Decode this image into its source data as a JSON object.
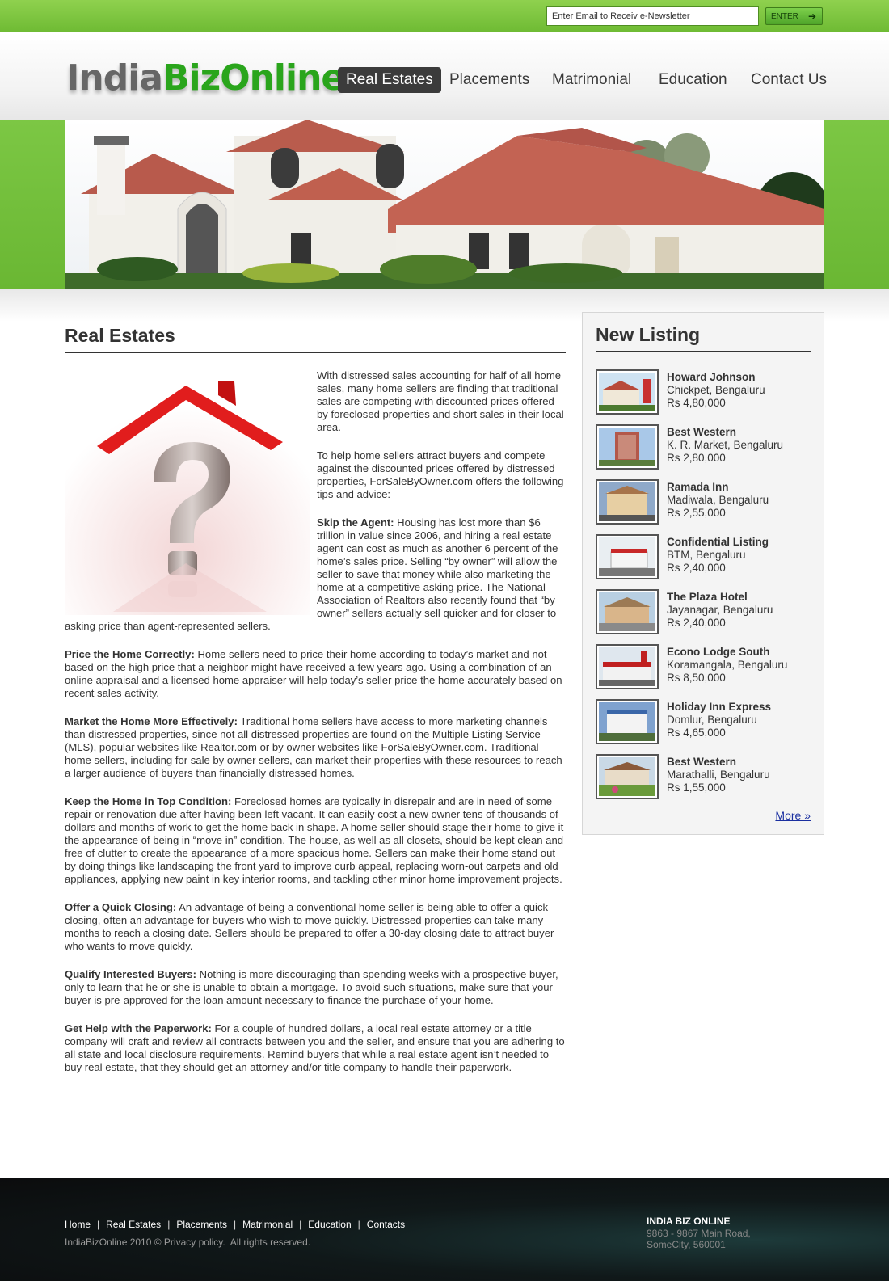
{
  "newsletter": {
    "input_value": "Enter Email to Receiv e-Newsletter",
    "button_label": "ENTER"
  },
  "header": {
    "logo_part1": "India",
    "logo_part2": "BizOnline",
    "nav": [
      {
        "label": "Real Estates",
        "active": true
      },
      {
        "label": "Placements"
      },
      {
        "label": "Matrimonial"
      },
      {
        "label": "Education"
      },
      {
        "label": "Contact Us"
      }
    ]
  },
  "main": {
    "title": "Real Estates",
    "paragraphs": [
      {
        "lead": "",
        "text": "With distressed sales accounting for half of all home sales, many home sellers are finding that traditional sales are competing with discounted prices offered by foreclosed properties and short sales in their local area."
      },
      {
        "lead": "",
        "text": "To help home sellers attract buyers and compete against the discounted prices offered by distressed properties, ForSaleByOwner.com offers the following tips and advice:"
      },
      {
        "lead": "Skip the Agent:",
        "text": " Housing has lost more than $6 trillion in value since 2006, and hiring a real estate agent can cost as much as another 6 percent of the home’s sales price. Selling “by owner” will allow the seller to save that money while also marketing the home at a competitive asking price. The National Association of Realtors also recently found that “by owner” sellers actually sell quicker and for closer to asking price than agent-represented sellers."
      },
      {
        "lead": "Price the Home Correctly:",
        "text": " Home sellers need to price their home according to today’s market and not based on the high price that a neighbor might have received a few years ago. Using a combination of an online appraisal and a licensed home appraiser will help today’s seller price the home accurately based on recent sales activity."
      },
      {
        "lead": "Market the Home More Effectively:",
        "text": " Traditional home sellers have access to more marketing channels than distressed properties, since not all distressed properties are found on the Multiple Listing Service (MLS), popular websites like Realtor.com or by owner websites like ForSaleByOwner.com. Traditional home sellers, including for sale by owner sellers, can market their properties with these resources to reach a larger audience of buyers than financially distressed homes."
      },
      {
        "lead": "Keep the Home in Top Condition:",
        "text": " Foreclosed homes are typically in disrepair and are in need of some repair or renovation due after having been left vacant. It can easily cost a new owner tens of thousands of dollars and months of work to get the home back in shape. A home seller should stage their home to give it the appearance of being in “move in” condition. The house, as well as all closets, should be kept clean and free of clutter to create the appearance of a more spacious home.  Sellers can make their home stand out by doing things like landscaping the front yard to improve curb appeal, replacing worn-out carpets and old appliances, applying new paint in key interior rooms, and tackling other minor home improvement projects."
      },
      {
        "lead": "Offer a Quick Closing:",
        "text": " An advantage of being a conventional home seller is being able to offer a quick closing, often an advantage for buyers who wish to move quickly. Distressed properties can take many months to reach a closing date. Sellers should be prepared to offer a 30-day closing date to attract buyer who wants to move quickly."
      },
      {
        "lead": "Qualify Interested Buyers:",
        "text": " Nothing is more discouraging than spending weeks with a prospective buyer, only to learn that he or she is unable to obtain a mortgage. To avoid such situations, make sure that your buyer is pre-approved for the loan amount necessary to finance the purchase of your home."
      },
      {
        "lead": "Get Help with the Paperwork:",
        "text": " For a couple of hundred dollars, a local real estate attorney or a title company will craft and review all contracts between you and the seller, and ensure that you are adhering to all state and local disclosure requirements. Remind buyers that while a real estate agent isn’t needed to buy real estate, that they should get an attorney and/or title company to handle their paperwork."
      }
    ]
  },
  "sidebar": {
    "title": "New Listing",
    "listings": [
      {
        "name": "Howard Johnson",
        "location": "Chickpet, Bengaluru",
        "price": "Rs 4,80,000"
      },
      {
        "name": "Best Western",
        "location": "K. R. Market, Bengaluru",
        "price": "Rs 2,80,000"
      },
      {
        "name": "Ramada Inn",
        "location": "Madiwala, Bengaluru",
        "price": "Rs 2,55,000"
      },
      {
        "name": "Confidential Listing",
        "location": "BTM, Bengaluru",
        "price": "Rs 2,40,000"
      },
      {
        "name": "The Plaza Hotel",
        "location": "Jayanagar, Bengaluru",
        "price": "Rs 2,40,000"
      },
      {
        "name": "Econo Lodge South",
        "location": "Koramangala, Bengaluru",
        "price": "Rs 8,50,000"
      },
      {
        "name": "Holiday Inn Express",
        "location": "Domlur, Bengaluru",
        "price": "Rs 4,65,000"
      },
      {
        "name": "Best Western",
        "location": "Marathalli, Bengaluru",
        "price": "Rs 1,55,000"
      }
    ],
    "more_label": "More »"
  },
  "footer": {
    "links": [
      "Home",
      "Real Estates",
      "Placements",
      "Matrimonial",
      "Education",
      "Contacts"
    ],
    "separator": "|",
    "copyright_prefix": "IndiaBizOnline 2010 © ",
    "privacy_label": "Privacy policy.",
    "copyright_suffix": "  All rights reserved.",
    "company": "INDIA BIZ ONLINE",
    "address1": "9863 - 9867 Main Road,",
    "address2": "SomeCity, 560001"
  }
}
